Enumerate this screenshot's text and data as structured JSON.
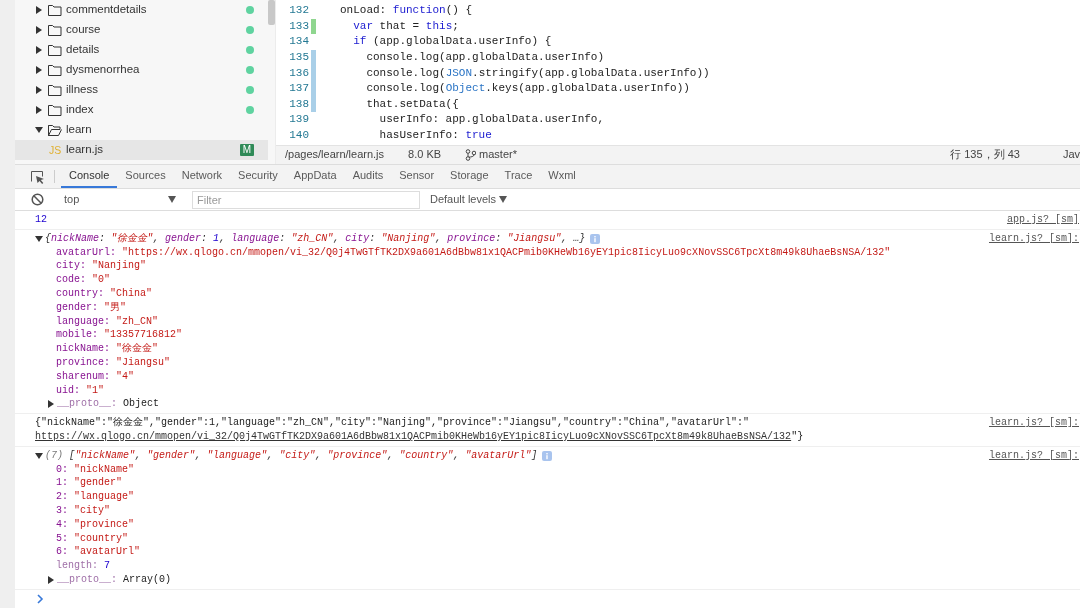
{
  "file_tree": {
    "items": [
      {
        "name": "commentdetails",
        "kind": "folder",
        "expanded": false,
        "selected": false,
        "color": "#5fd3a0"
      },
      {
        "name": "course",
        "kind": "folder",
        "expanded": false,
        "selected": false,
        "color": "#5fd3a0"
      },
      {
        "name": "details",
        "kind": "folder",
        "expanded": false,
        "selected": false,
        "color": "#5fd3a0"
      },
      {
        "name": "dysmenorrhea",
        "kind": "folder",
        "expanded": false,
        "selected": false,
        "color": "#5fd3a0"
      },
      {
        "name": "illness",
        "kind": "folder",
        "expanded": false,
        "selected": false,
        "color": "#5fd3a0"
      },
      {
        "name": "index",
        "kind": "folder",
        "expanded": false,
        "selected": false,
        "color": "#5fd3a0"
      },
      {
        "name": "learn",
        "kind": "folder",
        "expanded": true,
        "selected": false,
        "children": [
          {
            "name": "learn.js",
            "kind": "file",
            "icon_text": "JS",
            "badge": "M",
            "selected": true
          }
        ]
      }
    ]
  },
  "editor": {
    "lines": [
      {
        "number": "132",
        "added": false,
        "modified": false,
        "tokens": [
          {
            "text": "onLoad: ",
            "kind": "plain"
          },
          {
            "text": "function",
            "kind": "keyword"
          },
          {
            "text": "() {",
            "kind": "plain"
          }
        ]
      },
      {
        "number": "133",
        "added": true,
        "modified": false,
        "tokens": [
          {
            "text": "  var",
            "kind": "keyword"
          },
          {
            "text": " that = ",
            "kind": "plain"
          },
          {
            "text": "this",
            "kind": "keyword"
          },
          {
            "text": ";",
            "kind": "plain"
          }
        ]
      },
      {
        "number": "134",
        "added": false,
        "modified": false,
        "tokens": [
          {
            "text": "  if",
            "kind": "keyword"
          },
          {
            "text": " (app.globalData.userInfo) {",
            "kind": "plain"
          }
        ]
      },
      {
        "number": "135",
        "added": false,
        "modified": true,
        "tokens": [
          {
            "text": "    console.log(app.globalData.userInfo)",
            "kind": "plain"
          }
        ]
      },
      {
        "number": "136",
        "added": false,
        "modified": true,
        "tokens": [
          {
            "text": "    console.log(",
            "kind": "plain"
          },
          {
            "text": "JSON",
            "kind": "builtin"
          },
          {
            "text": ".stringify(app.globalData.userInfo))",
            "kind": "plain"
          }
        ]
      },
      {
        "number": "137",
        "added": false,
        "modified": true,
        "tokens": [
          {
            "text": "    console.log(",
            "kind": "plain"
          },
          {
            "text": "Object",
            "kind": "builtin"
          },
          {
            "text": ".keys(app.globalData.userInfo))",
            "kind": "plain"
          }
        ]
      },
      {
        "number": "138",
        "added": false,
        "modified": true,
        "tokens": [
          {
            "text": "    that.setData({",
            "kind": "plain"
          }
        ]
      },
      {
        "number": "139",
        "added": false,
        "modified": false,
        "tokens": [
          {
            "text": "      userInfo: app.globalData.userInfo,",
            "kind": "plain"
          }
        ]
      },
      {
        "number": "140",
        "added": false,
        "modified": false,
        "tokens": [
          {
            "text": "      hasUserInfo: ",
            "kind": "plain"
          },
          {
            "text": "true",
            "kind": "keyword"
          }
        ]
      }
    ]
  },
  "status_bar": {
    "path": "/pages/learn/learn.js",
    "size": "8.0 KB",
    "branch": "master*",
    "position": "行 135，列 43",
    "language": "Jav"
  },
  "devtools": {
    "tabs": [
      {
        "label": "Console",
        "selected": true
      },
      {
        "label": "Sources",
        "selected": false
      },
      {
        "label": "Network",
        "selected": false
      },
      {
        "label": "Security",
        "selected": false
      },
      {
        "label": "AppData",
        "selected": false
      },
      {
        "label": "Audits",
        "selected": false
      },
      {
        "label": "Sensor",
        "selected": false
      },
      {
        "label": "Storage",
        "selected": false
      },
      {
        "label": "Trace",
        "selected": false
      },
      {
        "label": "Wxml",
        "selected": false
      }
    ],
    "context": "top",
    "filter": {
      "placeholder": "Filter"
    },
    "levels": "Default levels"
  },
  "console": {
    "messages": [
      {
        "kind": "value",
        "text": "12",
        "source": "app.js? [sm]"
      },
      {
        "kind": "object",
        "expanded": true,
        "source": "learn.js? [sm]:",
        "summary": [
          {
            "text": "{",
            "kind": "punct"
          },
          {
            "text": "nickName",
            "kind": "key"
          },
          {
            "text": ": ",
            "kind": "punct"
          },
          {
            "text": "\"徐金金\"",
            "kind": "string"
          },
          {
            "text": ", ",
            "kind": "punct"
          },
          {
            "text": "gender",
            "kind": "key"
          },
          {
            "text": ": ",
            "kind": "punct"
          },
          {
            "text": "1",
            "kind": "number"
          },
          {
            "text": ", ",
            "kind": "punct"
          },
          {
            "text": "language",
            "kind": "key"
          },
          {
            "text": ": ",
            "kind": "punct"
          },
          {
            "text": "\"zh_CN\"",
            "kind": "string"
          },
          {
            "text": ", ",
            "kind": "punct"
          },
          {
            "text": "city",
            "kind": "key"
          },
          {
            "text": ": ",
            "kind": "punct"
          },
          {
            "text": "\"Nanjing\"",
            "kind": "string"
          },
          {
            "text": ", ",
            "kind": "punct"
          },
          {
            "text": "province",
            "kind": "key"
          },
          {
            "text": ": ",
            "kind": "punct"
          },
          {
            "text": "\"Jiangsu\"",
            "kind": "string"
          },
          {
            "text": ", …}",
            "kind": "punct"
          }
        ],
        "properties": [
          {
            "key": "avatarUrl:",
            "value": "\"https://wx.qlogo.cn/mmopen/vi_32/Q0j4TwGTfTK2DX9a601A6dBbw81x1QACPmib0KHeWb16yEY1pic8IicyLuo9cXNovSSC6TpcXt8m49k8UhaeBsNSA/132\"",
            "kind": "string"
          },
          {
            "key": "city:",
            "value": "\"Nanjing\"",
            "kind": "string"
          },
          {
            "key": "code:",
            "value": "\"0\"",
            "kind": "string"
          },
          {
            "key": "country:",
            "value": "\"China\"",
            "kind": "string"
          },
          {
            "key": "gender:",
            "value": "\"男\"",
            "kind": "string"
          },
          {
            "key": "language:",
            "value": "\"zh_CN\"",
            "kind": "string"
          },
          {
            "key": "mobile:",
            "value": "\"13357716812\"",
            "kind": "string"
          },
          {
            "key": "nickName:",
            "value": "\"徐金金\"",
            "kind": "string"
          },
          {
            "key": "province:",
            "value": "\"Jiangsu\"",
            "kind": "string"
          },
          {
            "key": "sharenum:",
            "value": "\"4\"",
            "kind": "string"
          },
          {
            "key": "uid:",
            "value": "\"1\"",
            "kind": "string"
          }
        ],
        "proto": {
          "key": "__proto__:",
          "value": "Object",
          "expanded": false
        }
      },
      {
        "kind": "text",
        "source": "learn.js? [sm]:",
        "text": "{\"nickName\":\"徐金金\",\"gender\":1,\"language\":\"zh_CN\",\"city\":\"Nanjing\",\"province\":\"Jiangsu\",\"country\":\"China\",\"avatarUrl\":\"",
        "link": "https://wx.qlogo.cn/mmopen/vi_32/Q0j4TwGTfTK2DX9a601A6dBbw81x1QACPmib0KHeWb16yEY1pic8IicyLuo9cXNovSSC6TpcXt8m49k8UhaeBsNSA/132",
        "suffix": "\"}"
      },
      {
        "kind": "object",
        "expanded": true,
        "source": "learn.js? [sm]:",
        "summary": [
          {
            "text": "(7) ",
            "kind": "count"
          },
          {
            "text": "[",
            "kind": "punct"
          },
          {
            "text": "\"nickName\"",
            "kind": "string"
          },
          {
            "text": ", ",
            "kind": "punct"
          },
          {
            "text": "\"gender\"",
            "kind": "string"
          },
          {
            "text": ", ",
            "kind": "punct"
          },
          {
            "text": "\"language\"",
            "kind": "string"
          },
          {
            "text": ", ",
            "kind": "punct"
          },
          {
            "text": "\"city\"",
            "kind": "string"
          },
          {
            "text": ", ",
            "kind": "punct"
          },
          {
            "text": "\"province\"",
            "kind": "string"
          },
          {
            "text": ", ",
            "kind": "punct"
          },
          {
            "text": "\"country\"",
            "kind": "string"
          },
          {
            "text": ", ",
            "kind": "punct"
          },
          {
            "text": "\"avatarUrl\"",
            "kind": "string"
          },
          {
            "text": "]",
            "kind": "punct"
          }
        ],
        "properties": [
          {
            "key": "0:",
            "value": "\"nickName\"",
            "kind": "string"
          },
          {
            "key": "1:",
            "value": "\"gender\"",
            "kind": "string"
          },
          {
            "key": "2:",
            "value": "\"language\"",
            "kind": "string"
          },
          {
            "key": "3:",
            "value": "\"city\"",
            "kind": "string"
          },
          {
            "key": "4:",
            "value": "\"province\"",
            "kind": "string"
          },
          {
            "key": "5:",
            "value": "\"country\"",
            "kind": "string"
          },
          {
            "key": "6:",
            "value": "\"avatarUrl\"",
            "kind": "string"
          },
          {
            "key": "length:",
            "value": "7",
            "kind": "number",
            "dim": true
          }
        ],
        "proto": {
          "key": "__proto__:",
          "value": "Array(0)",
          "expanded": false
        }
      }
    ]
  }
}
